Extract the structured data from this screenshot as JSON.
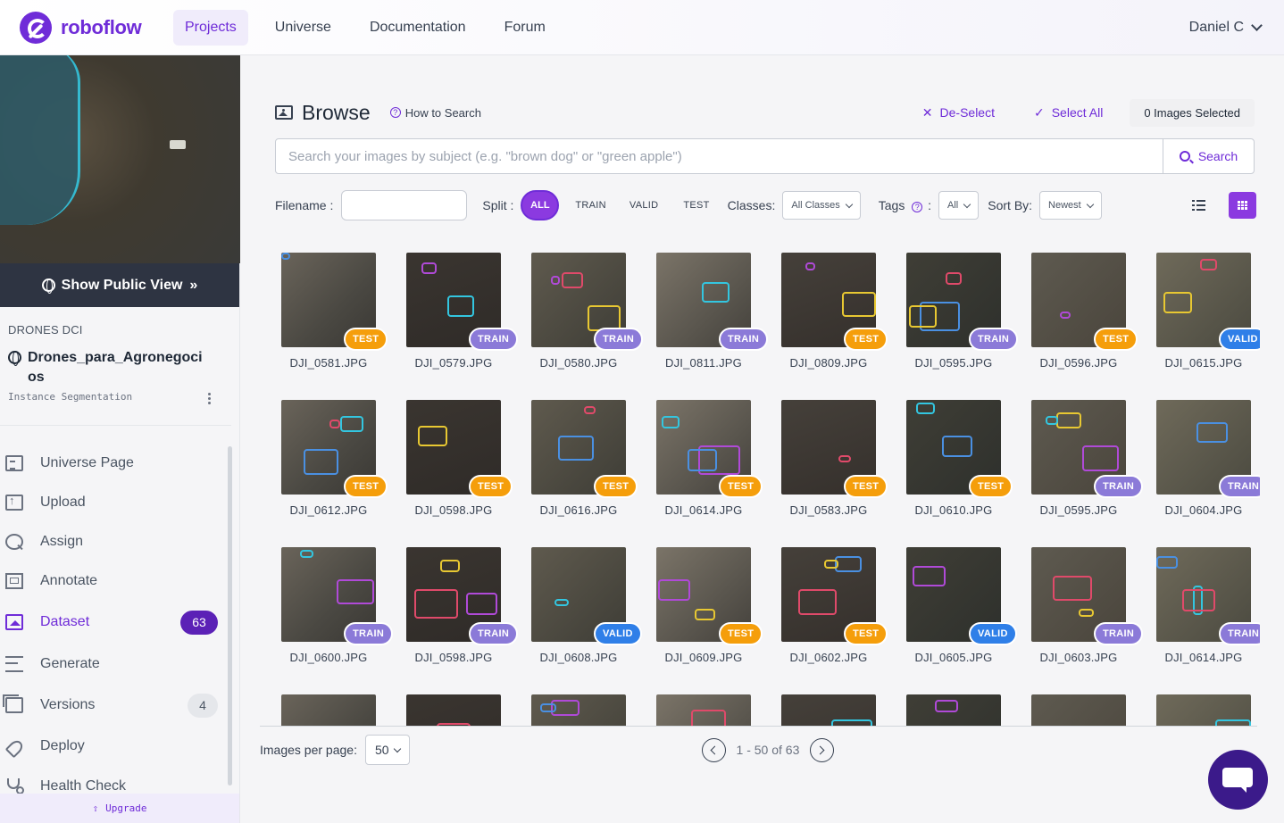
{
  "nav": {
    "brand": "roboflow",
    "items": [
      "Projects",
      "Universe",
      "Documentation",
      "Forum"
    ],
    "active": "Projects",
    "user": "Daniel C"
  },
  "sidebar": {
    "show_public": "Show Public View",
    "workspace": "DRONES DCI",
    "project_name": "Drones_para_Agronegocios",
    "project_type": "Instance Segmentation",
    "menu": [
      {
        "label": "Universe Page",
        "icon": "document-icon"
      },
      {
        "label": "Upload",
        "icon": "upload-icon"
      },
      {
        "label": "Assign",
        "icon": "search-icon"
      },
      {
        "label": "Annotate",
        "icon": "annotate-icon"
      },
      {
        "label": "Dataset",
        "icon": "image-icon",
        "count": "63",
        "active": true
      },
      {
        "label": "Generate",
        "icon": "sliders-icon"
      },
      {
        "label": "Versions",
        "icon": "versions-icon",
        "count": "4"
      },
      {
        "label": "Deploy",
        "icon": "rocket-icon"
      },
      {
        "label": "Health Check",
        "icon": "stethoscope-icon"
      }
    ],
    "upgrade": "Upgrade"
  },
  "browse": {
    "title": "Browse",
    "how_to": "How to Search",
    "deselect": "De-Select",
    "select_all": "Select All",
    "selected": "0 Images Selected",
    "search_placeholder": "Search your images by subject (e.g. \"brown dog\" or \"green apple\")",
    "search_button": "Search"
  },
  "filters": {
    "filename_label": "Filename :",
    "split_label": "Split :",
    "split_options": [
      "ALL",
      "TRAIN",
      "VALID",
      "TEST"
    ],
    "split_selected": "ALL",
    "classes_label": "Classes:",
    "classes_value": "All Classes",
    "tags_label": "Tags",
    "tags_colon": ":",
    "tags_value": "All",
    "sort_label": "Sort By:",
    "sort_value": "Newest"
  },
  "colors": {
    "accent": "#6f2cd8",
    "test": "#f59e0b",
    "train": "#8b7ad8",
    "valid": "#2f7fe8"
  },
  "images": [
    {
      "name": "DJI_0581.JPG",
      "split": "TEST"
    },
    {
      "name": "DJI_0579.JPG",
      "split": "TRAIN"
    },
    {
      "name": "DJI_0580.JPG",
      "split": "TRAIN"
    },
    {
      "name": "DJI_0811.JPG",
      "split": "TRAIN"
    },
    {
      "name": "DJI_0809.JPG",
      "split": "TEST"
    },
    {
      "name": "DJI_0595.JPG",
      "split": "TRAIN"
    },
    {
      "name": "DJI_0596.JPG",
      "split": "TEST"
    },
    {
      "name": "DJI_0615.JPG",
      "split": "VALID"
    },
    {
      "name": "DJI_0612.JPG",
      "split": "TEST"
    },
    {
      "name": "DJI_0598.JPG",
      "split": "TEST"
    },
    {
      "name": "DJI_0616.JPG",
      "split": "TEST"
    },
    {
      "name": "DJI_0614.JPG",
      "split": "TEST"
    },
    {
      "name": "DJI_0583.JPG",
      "split": "TEST"
    },
    {
      "name": "DJI_0610.JPG",
      "split": "TEST"
    },
    {
      "name": "DJI_0595.JPG",
      "split": "TRAIN"
    },
    {
      "name": "DJI_0604.JPG",
      "split": "TRAIN"
    },
    {
      "name": "DJI_0600.JPG",
      "split": "TRAIN"
    },
    {
      "name": "DJI_0598.JPG",
      "split": "TRAIN"
    },
    {
      "name": "DJI_0608.JPG",
      "split": "VALID"
    },
    {
      "name": "DJI_0609.JPG",
      "split": "TEST"
    },
    {
      "name": "DJI_0602.JPG",
      "split": "TEST"
    },
    {
      "name": "DJI_0605.JPG",
      "split": "VALID"
    },
    {
      "name": "DJI_0603.JPG",
      "split": "TRAIN"
    },
    {
      "name": "DJI_0614.JPG",
      "split": "TRAIN"
    },
    {
      "name": "",
      "split": ""
    },
    {
      "name": "",
      "split": ""
    },
    {
      "name": "",
      "split": ""
    },
    {
      "name": "",
      "split": ""
    },
    {
      "name": "",
      "split": ""
    },
    {
      "name": "",
      "split": ""
    },
    {
      "name": "",
      "split": ""
    },
    {
      "name": "",
      "split": ""
    }
  ],
  "pager": {
    "per_page_label": "Images per page:",
    "per_page": "50",
    "range": "1 - 50 of 63"
  }
}
